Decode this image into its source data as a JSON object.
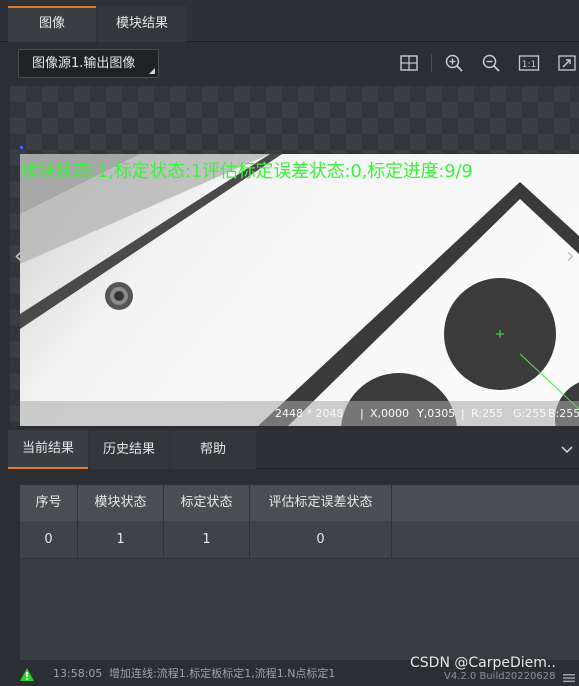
{
  "top_tabs": {
    "image": "图像",
    "module_result": "模块结果"
  },
  "toolbar": {
    "source_select": "图像源1.输出图像",
    "zoom_one": "1:1"
  },
  "viewer": {
    "overlay_text": "模块状态:1,标定状态:1评估标定误差状态:0,标定进度:9/9",
    "size": "2448 * 2048",
    "coord_x": "X,0000",
    "coord_y": "Y,0305",
    "r": "R:255",
    "g": "G:255",
    "b": "B:255"
  },
  "bottom_tabs": {
    "current": "当前结果",
    "history": "历史结果",
    "help": "帮助"
  },
  "results_table": {
    "headers": [
      "序号",
      "模块状态",
      "标定状态",
      "评估标定误差状态"
    ],
    "rows": [
      [
        "0",
        "1",
        "1",
        "0"
      ]
    ]
  },
  "status": {
    "time": "13:58:05",
    "message": "增加连线:流程1.标定板标定1,流程1.N点标定1",
    "watermark": "CSDN @CarpeDiem..",
    "version": "V4.2.0 Build20220628"
  },
  "colors": {
    "accent": "#e27a2a",
    "overlay": "#3cf23c",
    "warning": "#2bd12b"
  }
}
